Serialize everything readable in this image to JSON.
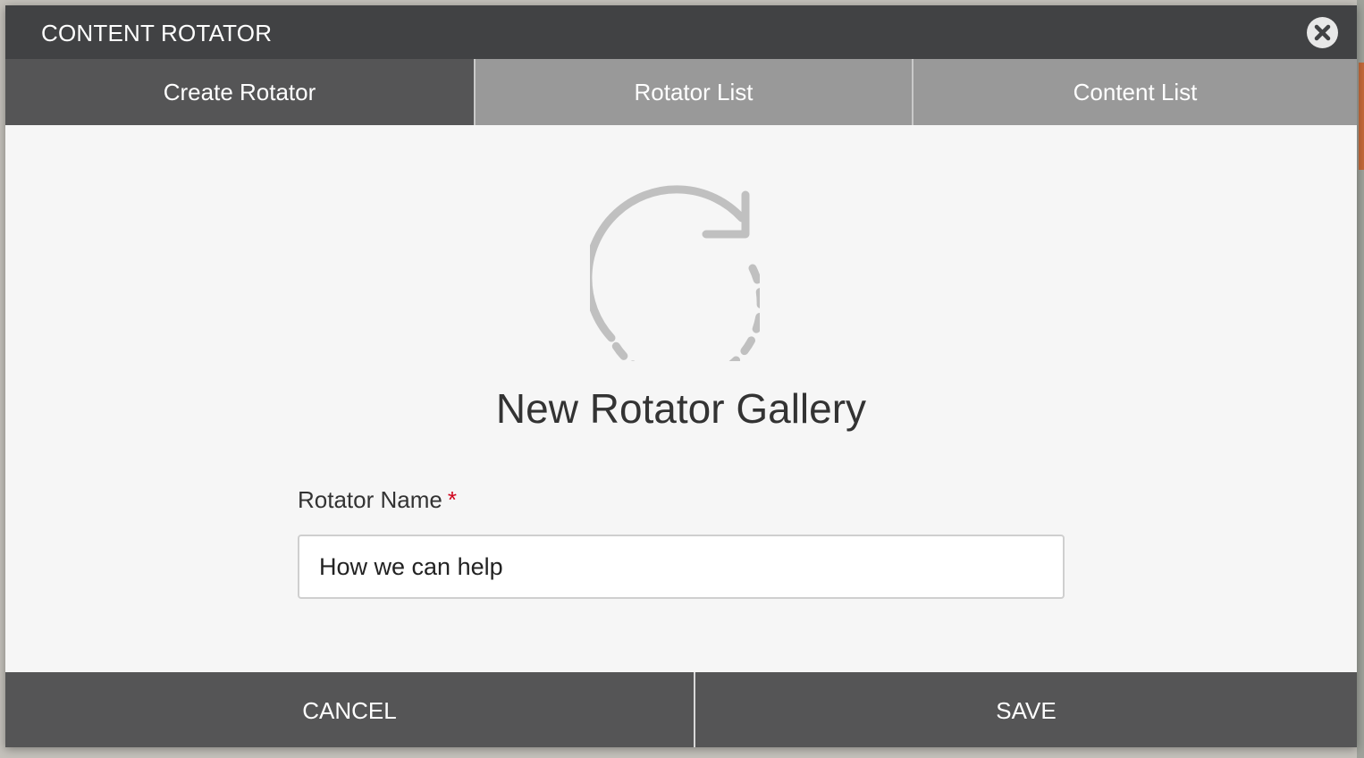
{
  "dialog": {
    "title": "CONTENT ROTATOR"
  },
  "tabs": [
    {
      "label": "Create Rotator",
      "active": true
    },
    {
      "label": "Rotator List",
      "active": false
    },
    {
      "label": "Content List",
      "active": false
    }
  ],
  "main": {
    "icon": "rotate-dashed-arrow-icon",
    "heading": "New Rotator Gallery",
    "field_label": "Rotator Name",
    "required_mark": "*",
    "name_value": "How we can help"
  },
  "footer": {
    "cancel_label": "CANCEL",
    "save_label": "SAVE"
  },
  "colors": {
    "titlebar": "#414244",
    "active_tab": "#555556",
    "inactive_tab": "#999999",
    "body": "#f6f6f6",
    "required": "#d0021b",
    "icon": "#c0c0c0"
  }
}
